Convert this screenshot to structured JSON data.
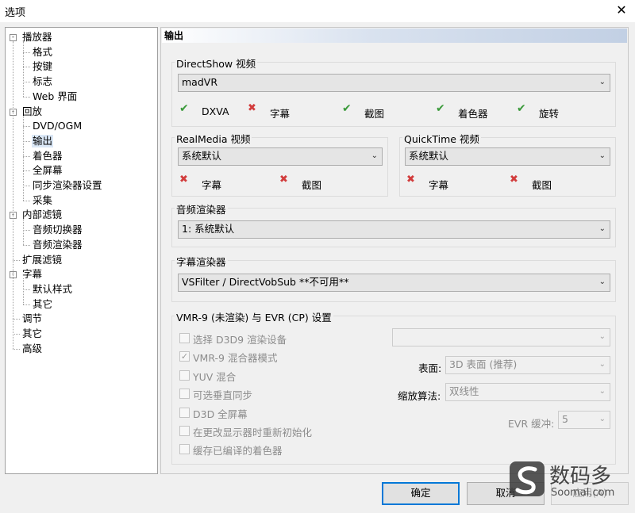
{
  "window": {
    "title": "选项",
    "close_icon": "close-icon"
  },
  "tree": {
    "items": [
      {
        "label": "播放器",
        "level": 0
      },
      {
        "label": "格式",
        "level": 1
      },
      {
        "label": "按键",
        "level": 1
      },
      {
        "label": "标志",
        "level": 1
      },
      {
        "label": "Web 界面",
        "level": 1
      },
      {
        "label": "回放",
        "level": 0
      },
      {
        "label": "DVD/OGM",
        "level": 1
      },
      {
        "label": "输出",
        "level": 1,
        "selected": true
      },
      {
        "label": "着色器",
        "level": 1
      },
      {
        "label": "全屏幕",
        "level": 1
      },
      {
        "label": "同步渲染器设置",
        "level": 1
      },
      {
        "label": "采集",
        "level": 1
      },
      {
        "label": "内部滤镜",
        "level": 0
      },
      {
        "label": "音频切换器",
        "level": 1
      },
      {
        "label": "音频渲染器",
        "level": 1
      },
      {
        "label": "扩展滤镜",
        "level": 0
      },
      {
        "label": "字幕",
        "level": 0
      },
      {
        "label": "默认样式",
        "level": 1
      },
      {
        "label": "其它",
        "level": 1
      },
      {
        "label": "调节",
        "level": 0
      },
      {
        "label": "其它",
        "level": 0
      },
      {
        "label": "高级",
        "level": 0
      }
    ],
    "expander_symbol": "-"
  },
  "panel": {
    "header": "输出"
  },
  "directshow": {
    "label": "DirectShow 视频",
    "value": "madVR",
    "features": [
      {
        "label": "DXVA",
        "state": "check"
      },
      {
        "label": "字幕",
        "state": "cross"
      },
      {
        "label": "截图",
        "state": "check"
      },
      {
        "label": "着色器",
        "state": "check"
      },
      {
        "label": "旋转",
        "state": "check"
      }
    ]
  },
  "realmedia": {
    "label": "RealMedia 视频",
    "value": "系统默认",
    "features": [
      {
        "label": "字幕",
        "state": "cross"
      },
      {
        "label": "截图",
        "state": "cross"
      }
    ]
  },
  "quicktime": {
    "label": "QuickTime 视频",
    "value": "系统默认",
    "features": [
      {
        "label": "字幕",
        "state": "cross"
      },
      {
        "label": "截图",
        "state": "cross"
      }
    ]
  },
  "audio": {
    "label": "音频渲染器",
    "value": "1: 系统默认"
  },
  "subtitle": {
    "label": "字幕渲染器",
    "value": "VSFilter / DirectVobSub **不可用**"
  },
  "vmr": {
    "label": "VMR-9 (未渲染) 与 EVR (CP) 设置",
    "checkboxes": [
      {
        "label": "选择 D3D9 渲染设备",
        "checked": false
      },
      {
        "label": "VMR-9 混合器模式",
        "checked": true
      },
      {
        "label": "YUV 混合",
        "checked": false
      },
      {
        "label": "可选垂直同步",
        "checked": false
      },
      {
        "label": "D3D 全屏幕",
        "checked": false
      },
      {
        "label": "在更改显示器时重新初始化",
        "checked": false
      },
      {
        "label": "缓存已编译的着色器",
        "checked": false
      }
    ],
    "surface_label": "表面:",
    "surface_value": "3D 表面 (推荐)",
    "resize_label": "缩放算法:",
    "resize_value": "双线性",
    "evr_label": "EVR 缓冲:",
    "evr_value": "5"
  },
  "buttons": {
    "ok": "确定",
    "cancel": "取消",
    "apply": "应用(A)"
  },
  "watermark": {
    "name": "数码多",
    "site": "Soomal.com"
  },
  "glyphs": {
    "check": "✔",
    "cross": "✖",
    "arrow": "⌄",
    "checkmark": "✓"
  },
  "colors": {
    "check": "#3a9a3a",
    "cross": "#d23c3c",
    "default_button_border": "#0078d7"
  }
}
